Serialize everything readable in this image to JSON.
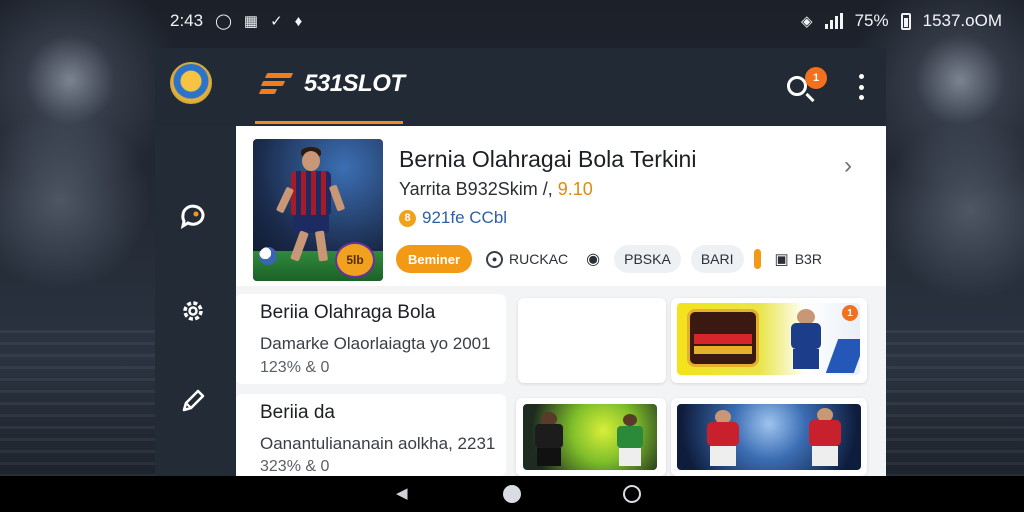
{
  "status_bar": {
    "left_time": "2:43",
    "left_icons": [
      "alarm-icon",
      "gallery-icon",
      "bluetooth-icon",
      "shield-icon"
    ],
    "battery": "75%",
    "right_clock": "1537.oOM"
  },
  "header": {
    "brand": "531SLOT",
    "notification_count": "1"
  },
  "sidebar": {
    "items": [
      {
        "icon": "chat-bubble-icon"
      },
      {
        "icon": "gear-icon"
      },
      {
        "icon": "pencil-icon"
      },
      {
        "icon": "settings-cog-icon"
      }
    ]
  },
  "featured": {
    "title": "Bernia Olahragai Bola Terkini",
    "subtitle_prefix": "Yarrita B932Skim /,",
    "subtitle_highlight": "9.10",
    "meta": "921fe CCbl",
    "coin_glyph": "8",
    "thumb_badge": "5lb",
    "chips": {
      "primary": "Beminer",
      "chip1": "RUCKAC",
      "chip3": "PBSKA",
      "chip4": "BARI",
      "chip5": "B3R"
    }
  },
  "articles": [
    {
      "title": "Beriia Olahraga Bola",
      "subtitle": "Damarke Olaorlaiagta yo 2001",
      "meta": "123% & 0"
    },
    {
      "title": "Beriia da",
      "subtitle": "Oanantuliananain aolkha, 2231",
      "meta": "323% & 0"
    }
  ],
  "tile_badge": "1",
  "colors": {
    "accent": "#f29a15",
    "header_bg": "#222a35",
    "sidebar_bg": "#232b36",
    "link_blue": "#2f5fa8"
  }
}
